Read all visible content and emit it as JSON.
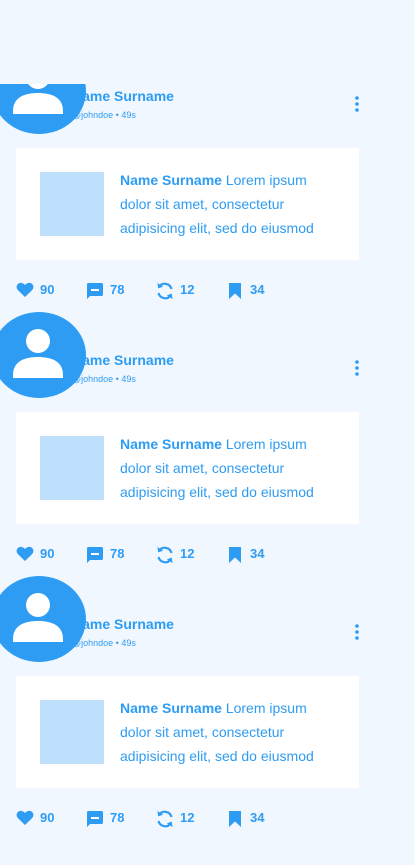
{
  "colors": {
    "background": "#f0f7fe",
    "accent": "#2e9cf3",
    "card": "#ffffff",
    "thumbnail": "#bee0fc"
  },
  "posts": [
    {
      "author_name": "Name Surname",
      "author_meta": "@johndoe • 49s",
      "card_name": "Name Surname",
      "card_text": " Lorem ipsum dolor sit amet, consectetur adipisicing elit, sed do eiusmod",
      "likes": "90",
      "comments": "78",
      "reposts": "12",
      "bookmarks": "34"
    },
    {
      "author_name": "Name Surname",
      "author_meta": "@johndoe • 49s",
      "card_name": "Name Surname",
      "card_text": " Lorem ipsum dolor sit amet, consectetur adipisicing elit, sed do eiusmod",
      "likes": "90",
      "comments": "78",
      "reposts": "12",
      "bookmarks": "34"
    },
    {
      "author_name": "Name Surname",
      "author_meta": "@johndoe • 49s",
      "card_name": "Name Surname",
      "card_text": " Lorem ipsum dolor sit amet, consectetur adipisicing elit, sed do eiusmod",
      "likes": "90",
      "comments": "78",
      "reposts": "12",
      "bookmarks": "34"
    }
  ]
}
